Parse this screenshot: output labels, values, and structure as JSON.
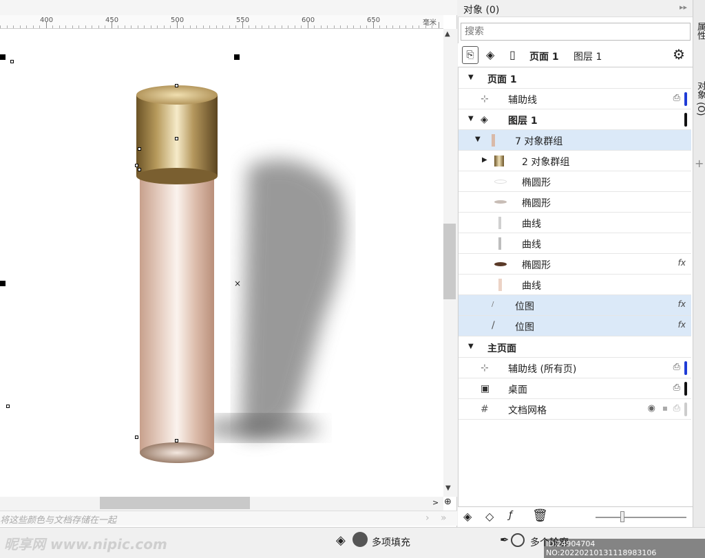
{
  "ruler": {
    "labels": [
      "400",
      "450",
      "500",
      "550",
      "600",
      "650",
      "毫米"
    ]
  },
  "canvas": {
    "hint": "将这些颜色与文档存储在一起"
  },
  "panel": {
    "title": "对象 (0)",
    "search_placeholder": "搜索",
    "page_label": "页面 1",
    "layer_label": "图层 1",
    "rows": [
      {
        "label": "页面 1"
      },
      {
        "label": "辅助线"
      },
      {
        "label": "图层 1"
      },
      {
        "label": "7 对象群组"
      },
      {
        "label": "2 对象群组"
      },
      {
        "label": "椭圆形"
      },
      {
        "label": "椭圆形"
      },
      {
        "label": "曲线"
      },
      {
        "label": "曲线"
      },
      {
        "label": "椭圆形",
        "fx": "fx"
      },
      {
        "label": "曲线"
      },
      {
        "label": "位图",
        "fx": "fx"
      },
      {
        "label": "位图",
        "fx": "fx"
      },
      {
        "label": "主页面"
      },
      {
        "label": "辅助线 (所有页)"
      },
      {
        "label": "桌面"
      },
      {
        "label": "文档网格"
      }
    ]
  },
  "side_tabs": {
    "properties": "属性",
    "objects": "对象 (O)"
  },
  "status": {
    "fill_label": "多项填充",
    "outline_label": "多个轮廓",
    "watermark_left": "昵享网 www.nipic.com",
    "watermark_right": "ID:24904704 NO:20220210131118983106"
  },
  "colors": {
    "accent_blue": "#1f3cd6",
    "selection": "#dbe9f8",
    "gold": "#b89a5c",
    "tube": "#d9b9a8"
  },
  "icons": [
    "page-icon",
    "layers-icon",
    "document-icon",
    "gear-icon",
    "guide-icon",
    "lock-icon",
    "eye-icon",
    "grid-icon",
    "new-layer-icon",
    "new-master-layer-icon",
    "new-effect-icon",
    "delete-icon",
    "zoom-icon",
    "fill-icon",
    "outline-icon"
  ]
}
